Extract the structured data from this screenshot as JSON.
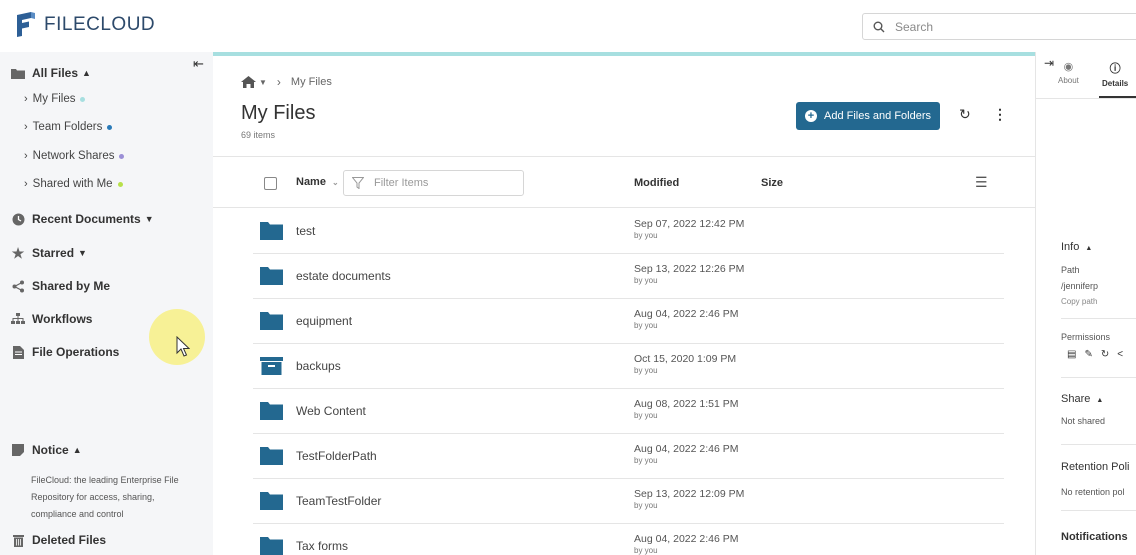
{
  "app": {
    "logo_text": "FILECLOUD",
    "brand_color": "#236890"
  },
  "search": {
    "placeholder": "Search"
  },
  "sidebar": {
    "all_files": "All Files",
    "sub_items": [
      {
        "label": "My Files",
        "dot_color": "#a7dfe0"
      },
      {
        "label": "Team Folders",
        "dot_color": "#2a7ab8"
      },
      {
        "label": "Network Shares",
        "dot_color": "#9b8fd6"
      },
      {
        "label": "Shared with Me",
        "dot_color": "#b8e04a"
      }
    ],
    "recent_documents": "Recent Documents",
    "starred": "Starred",
    "shared_by_me": "Shared by Me",
    "workflows": "Workflows",
    "file_operations": "File Operations",
    "notice": "Notice",
    "notice_text": "FileCloud: the leading Enterprise File Repository for access, sharing, compliance and control",
    "deleted_files": "Deleted Files"
  },
  "main": {
    "breadcrumb_current": "My Files",
    "title": "My Files",
    "item_count": "69 items",
    "add_button": "Add Files and Folders",
    "columns": {
      "name": "Name",
      "filter_placeholder": "Filter Items",
      "modified": "Modified",
      "size": "Size"
    },
    "rows": [
      {
        "name": "test",
        "modified": "Sep 07, 2022 12:42 PM",
        "by": "by you",
        "icon": "folder-icon"
      },
      {
        "name": "estate documents",
        "modified": "Sep 13, 2022 12:26 PM",
        "by": "by you",
        "icon": "folder-icon"
      },
      {
        "name": "equipment",
        "modified": "Aug 04, 2022 2:46 PM",
        "by": "by you",
        "icon": "folder-icon"
      },
      {
        "name": "backups",
        "modified": "Oct 15, 2020 1:09 PM",
        "by": "by you",
        "icon": "archive-icon"
      },
      {
        "name": "Web Content",
        "modified": "Aug 08, 2022 1:51 PM",
        "by": "by you",
        "icon": "folder-icon"
      },
      {
        "name": "TestFolderPath",
        "modified": "Aug 04, 2022 2:46 PM",
        "by": "by you",
        "icon": "folder-icon"
      },
      {
        "name": "TeamTestFolder",
        "modified": "Sep 13, 2022 12:09 PM",
        "by": "by you",
        "icon": "folder-icon"
      },
      {
        "name": "Tax forms",
        "modified": "Aug 04, 2022 2:46 PM",
        "by": "by you",
        "icon": "folder-icon"
      }
    ]
  },
  "right_panel": {
    "tabs": [
      "About",
      "Details"
    ],
    "active_tab": "Details",
    "info": "Info",
    "path_label": "Path",
    "path_value": "/jenniferp",
    "copy_path": "Copy path",
    "permissions": "Permissions",
    "share": "Share",
    "share_value": "Not shared",
    "retention": "Retention Poli",
    "retention_value": "No retention pol",
    "notifications": "Notifications"
  }
}
